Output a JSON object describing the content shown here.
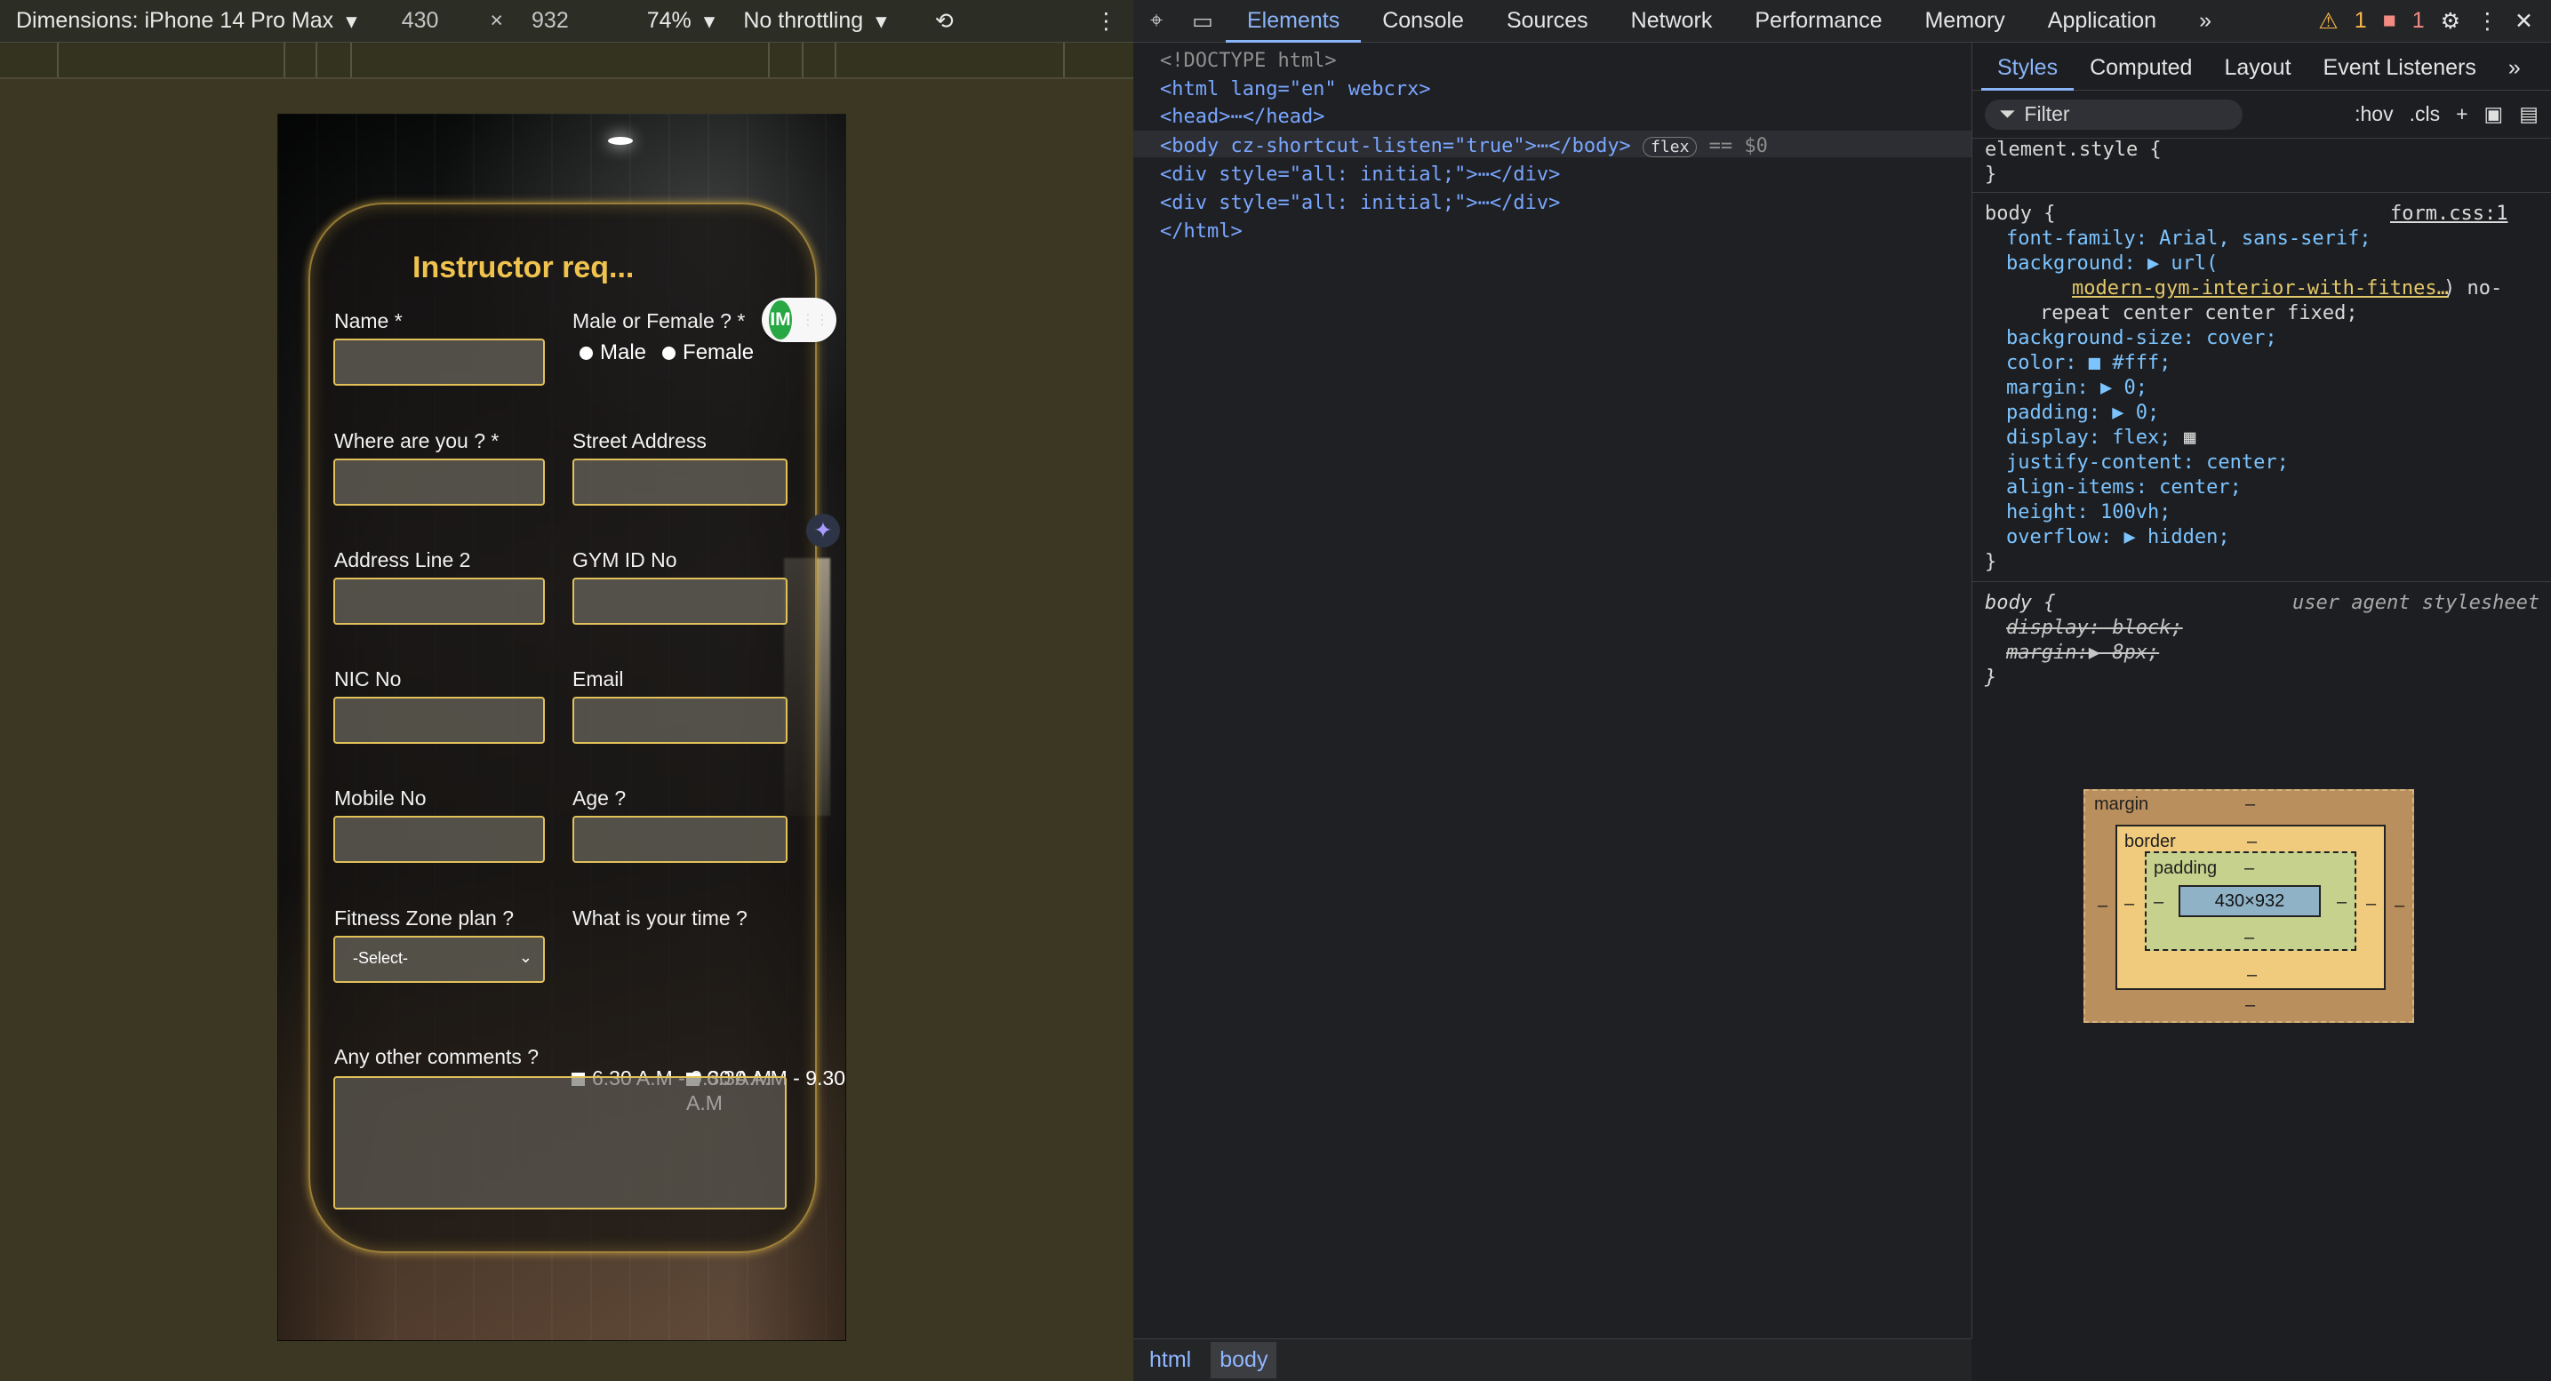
{
  "device_toolbar": {
    "dimensions_label": "Dimensions: iPhone 14 Pro Max",
    "width": "430",
    "x": "×",
    "height": "932",
    "zoom": "74%",
    "throttling": "No throttling"
  },
  "form": {
    "title": "Instructor req...",
    "labels": {
      "name": "Name *",
      "gender": "Male or Female ? *",
      "male": "Male",
      "female": "Female",
      "where": "Where are you ? *",
      "street": "Street Address",
      "address2": "Address Line 2",
      "gym": "GYM ID No",
      "nic": "NIC No",
      "email": "Email",
      "mobile": "Mobile No",
      "age": "Age ?",
      "fitness": "Fitness Zone plan ?",
      "time": "What is your time ?",
      "comments": "Any other comments ?"
    },
    "select_value": "-Select-",
    "time_options": [
      "6.30 A.M - 9.30 A.M",
      "6.30 A.M - 9.30 A.M"
    ],
    "badge_text": "IM"
  },
  "devtools": {
    "top_tabs": [
      "Elements",
      "Console",
      "Sources",
      "Network",
      "Performance",
      "Memory",
      "Application"
    ],
    "warnings": "1",
    "errors": "1",
    "code_lines": [
      "<!DOCTYPE html>",
      "<html lang=\"en\" webcrx>",
      "<head>⋯</head>",
      "<body cz-shortcut-listen=\"true\">⋯</body>",
      "flex",
      "== $0",
      "<div style=\"all: initial;\">⋯</div>",
      "<div style=\"all: initial;\">⋯</div>",
      "</html>"
    ],
    "breadcrumb": [
      "html",
      "body"
    ],
    "style_tabs": [
      "Styles",
      "Computed",
      "Layout",
      "Event Listeners"
    ],
    "filter_placeholder": "Filter",
    "hov": ":hov",
    "cls": ".cls",
    "styles": {
      "element_style": "element.style {",
      "close": "}",
      "body_selector": "body {",
      "source": "form.css:1",
      "font_family": "font-family: Arial, sans-serif;",
      "background": "background: ▶ url(",
      "background_link": "modern-gym-interior-with-fitnes…",
      "background_tail": ") no-",
      "background_wrap": "repeat center center fixed;",
      "background_size": "background-size: cover;",
      "color": "color: ■ #fff;",
      "margin": "margin: ▶ 0;",
      "padding": "padding: ▶ 0;",
      "display": "display: flex;",
      "justify": "justify-content: center;",
      "align": "align-items: center;",
      "height": "height: 100vh;",
      "overflow": "overflow: ▶ hidden;",
      "ua_selector": "body {",
      "ua_source": "user agent stylesheet",
      "ua_display": "display: block;",
      "ua_margin": "margin:▶ 8px;"
    },
    "box_model": {
      "margin": "margin",
      "border": "border",
      "padding": "padding",
      "content": "430×932",
      "dash": "–"
    }
  }
}
